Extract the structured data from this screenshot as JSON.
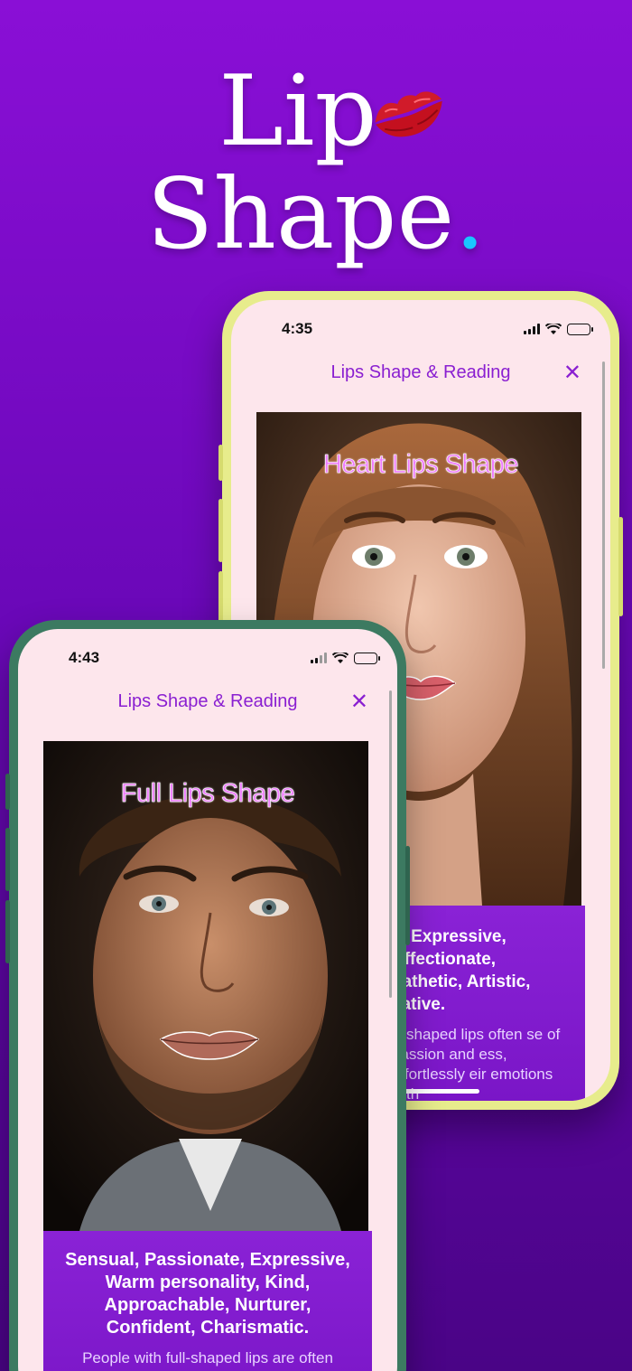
{
  "hero": {
    "line1": "Lip",
    "line2": "Shape",
    "dot": ".",
    "emoji_icon": "kiss-lips-icon"
  },
  "colors": {
    "background": "#7a0bc8",
    "accent_dot": "#19c6ff",
    "back_phone_frame": "#e7ec8c",
    "front_phone_frame": "#3c7a61",
    "navbar_text": "#8a1fd1"
  },
  "back_phone": {
    "status_time": "4:35",
    "nav_title": "Lips Shape & Reading",
    "close_label": "✕",
    "photo_label": "Heart Lips Shape",
    "traits": "e, Expressive, Affectionate, pathetic, Artistic, eative.",
    "description": "rt-shaped lips often se of passion and ess, effortlessly eir emotions with"
  },
  "front_phone": {
    "status_time": "4:43",
    "nav_title": "Lips Shape & Reading",
    "close_label": "✕",
    "photo_label": "Full Lips Shape",
    "traits": "Sensual, Passionate, Expressive, Warm personality, Kind, Approachable, Nurturer, Confident, Charismatic.",
    "description": "People with full-shaped lips are often"
  }
}
